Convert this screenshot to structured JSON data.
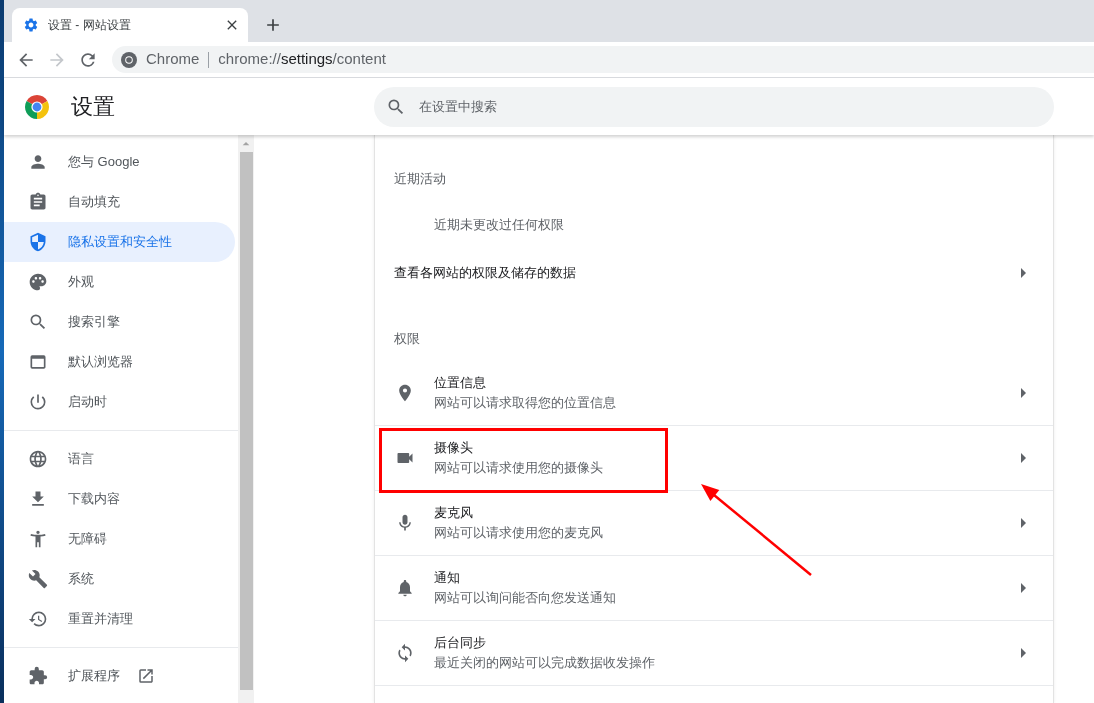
{
  "tabs": [
    {
      "title": "设置 - 网站设置",
      "selected": true
    }
  ],
  "toolbar": {
    "nav": [
      {
        "disabled": false
      },
      {
        "disabled": true
      },
      {
        "disabled": false
      }
    ],
    "omnibox": {
      "chip": "Chrome",
      "url": {
        "scheme": "chrome://",
        "host": "settings",
        "path": "/content"
      }
    }
  },
  "header": {
    "title": "设置",
    "search": {
      "placeholder": "在设置中搜索"
    }
  },
  "sidebar": {
    "groups": [
      {
        "items": [
          {
            "label": "您与 Google",
            "selected": false,
            "external": false
          },
          {
            "label": "自动填充",
            "selected": false,
            "external": false
          },
          {
            "label": "隐私设置和安全性",
            "selected": true,
            "external": false
          },
          {
            "label": "外观",
            "selected": false,
            "external": false
          },
          {
            "label": "搜索引擎",
            "selected": false,
            "external": false
          },
          {
            "label": "默认浏览器",
            "selected": false,
            "external": false
          },
          {
            "label": "启动时",
            "selected": false,
            "external": false
          }
        ]
      },
      {
        "items": [
          {
            "label": "语言",
            "selected": false,
            "external": false
          },
          {
            "label": "下载内容",
            "selected": false,
            "external": false
          },
          {
            "label": "无障碍",
            "selected": false,
            "external": false
          },
          {
            "label": "系统",
            "selected": false,
            "external": false
          },
          {
            "label": "重置并清理",
            "selected": false,
            "external": false
          }
        ]
      },
      {
        "items": [
          {
            "label": "扩展程序",
            "selected": false,
            "external": true
          }
        ]
      }
    ]
  },
  "content": {
    "recent": {
      "title": "近期活动",
      "empty_text": "近期未更改过任何权限"
    },
    "site_data_link": "查看各网站的权限及储存的数据",
    "permissions": {
      "title": "权限",
      "rows": [
        {
          "title": "位置信息",
          "subtitle": "网站可以请求取得您的位置信息",
          "highlighted": false
        },
        {
          "title": "摄像头",
          "subtitle": "网站可以请求使用您的摄像头",
          "highlighted": true
        },
        {
          "title": "麦克风",
          "subtitle": "网站可以请求使用您的麦克风",
          "highlighted": false
        },
        {
          "title": "通知",
          "subtitle": "网站可以询问能否向您发送通知",
          "highlighted": false
        },
        {
          "title": "后台同步",
          "subtitle": "最近关闭的网站可以完成数据收发操作",
          "highlighted": false
        }
      ]
    }
  }
}
